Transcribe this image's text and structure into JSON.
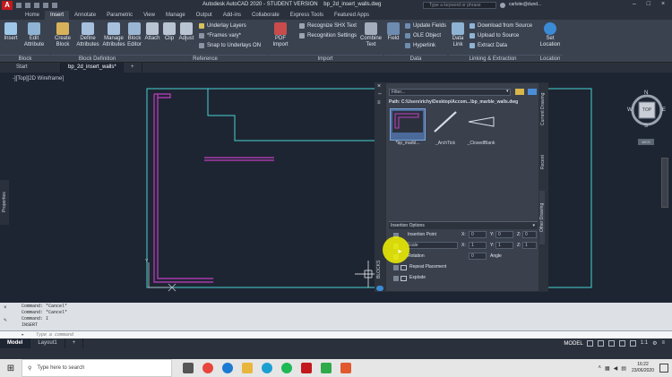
{
  "title": {
    "app_title": "Autodesk AutoCAD 2020 - STUDENT VERSION",
    "file_name": "bp_2d_insert_walls.dwg",
    "search_placeholder": "Type a keyword or phrase",
    "user": "carlsite@dund..."
  },
  "ribbon_tabs": [
    "Home",
    "Insert",
    "Annotate",
    "Parametric",
    "View",
    "Manage",
    "Output",
    "Add-ins",
    "Collaborate",
    "Express Tools",
    "Featured Apps"
  ],
  "ribbon": {
    "block": {
      "insert": "Insert",
      "edit_attribute": "Edit Attribute",
      "label": "Block"
    },
    "block_definition": {
      "create_block": "Create Block",
      "define_attributes": "Define Attributes",
      "manage_attributes": "Manage Attributes",
      "block_editor": "Block Editor",
      "label": "Block Definition"
    },
    "reference": {
      "attach": "Attach",
      "clip": "Clip",
      "adjust": "Adjust",
      "underlay_layers": "Underlay Layers",
      "frames_vary": "*Frames vary*",
      "snap_underlays": "Snap to Underlays ON",
      "label": "Reference"
    },
    "import": {
      "pdf_import": "PDF Import",
      "recognize_shx": "Recognize SHX Text",
      "recognition_settings": "Recognition Settings",
      "combine_text": "Combine Text",
      "label": "Import"
    },
    "data": {
      "field": "Field",
      "update_fields": "Update Fields",
      "ole_object": "OLE Object",
      "hyperlink": "Hyperlink",
      "label": "Data"
    },
    "linking": {
      "data_link": "Data Link",
      "download_source": "Download from Source",
      "upload_source": "Upload to Source",
      "extract_data": "Extract  Data",
      "label": "Linking & Extraction"
    },
    "location": {
      "set_location": "Set Location",
      "label": "Location"
    }
  },
  "doc_tabs": {
    "start": "Start",
    "drawing": "bp_2d_insert_walls*",
    "add": "+"
  },
  "viewport": {
    "label": "-][Top][2D Wireframe]"
  },
  "viewcube": {
    "north": "N",
    "south": "S",
    "east": "E",
    "west": "W",
    "top": "TOP",
    "wcs": "WCS"
  },
  "properties_tab": "Properties",
  "palette": {
    "filter": "Filter...",
    "path": "Path: C:\\Users\\richy\\Desktop\\Accom...\\bp_marble_walls.dwg",
    "items": [
      "*bp_marbl...",
      "_ArchTick",
      "_ClosedBlank"
    ],
    "side_tabs": [
      "Current Drawing",
      "Recent",
      "Other Drawing"
    ],
    "blocks_label": "BLOCKS",
    "insertion_options": "Insertion Options",
    "insertion_point": "Insertion Point",
    "scale": "Scale",
    "rotation": "Rotation",
    "angle": "Angle",
    "repeat_placement": "Repeat Placement",
    "explode": "Explode",
    "x": "X:",
    "y": "Y:",
    "z": "Z:",
    "ip_x": "0",
    "ip_y": "0",
    "ip_z": "0",
    "sc_x": "1",
    "sc_y": "1",
    "sc_z": "1",
    "rot": "0"
  },
  "command_history": [
    "Command: *Cancel*",
    "Command: *Cancel*",
    "Command: I",
    "INSERT"
  ],
  "command_placeholder": "Type a command",
  "layout_tabs": [
    "Model",
    "Layout1",
    "+"
  ],
  "status": {
    "model": "MODEL",
    "scale": "1:1"
  },
  "taskbar": {
    "search": "Type here to search",
    "time": "16:22",
    "date": "23/06/2020"
  },
  "colors": {
    "accent": "#1b7ad1",
    "wall": "#c23fc2",
    "frame": "#45d3d3",
    "highlight": "#f3f400"
  }
}
